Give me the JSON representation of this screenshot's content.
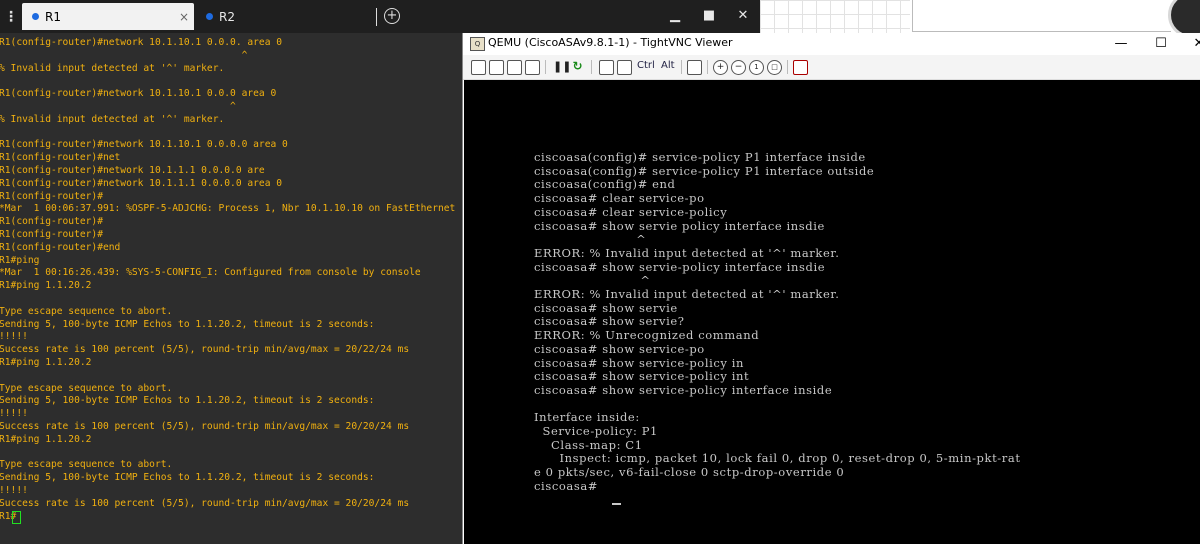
{
  "tabs": [
    {
      "label": "R1",
      "close": "×"
    },
    {
      "label": "R2",
      "close": "×"
    }
  ],
  "tab_menu_glyph": "⋮",
  "new_tab_glyph": "+",
  "window_controls": {
    "minimize": "▁",
    "maximize": "■",
    "close": "✕"
  },
  "terminal": {
    "text_color": "#f0b010",
    "lines": [
      "R1(config-router)#network 10.1.10.1 0.0.0. area 0",
      "                                          ^",
      "% Invalid input detected at '^' marker.",
      "",
      "R1(config-router)#network 10.1.10.1 0.0.0 area 0",
      "                                        ^",
      "% Invalid input detected at '^' marker.",
      "",
      "R1(config-router)#network 10.1.10.1 0.0.0.0 area 0",
      "R1(config-router)#net",
      "R1(config-router)#network 10.1.1.1 0.0.0.0 are",
      "R1(config-router)#network 10.1.1.1 0.0.0.0 area 0",
      "R1(config-router)#",
      "*Mar  1 00:06:37.991: %OSPF-5-ADJCHG: Process 1, Nbr 10.1.10.10 on FastEthernet",
      "R1(config-router)#",
      "R1(config-router)#",
      "R1(config-router)#end",
      "R1#ping",
      "*Mar  1 00:16:26.439: %SYS-5-CONFIG_I: Configured from console by console",
      "R1#ping 1.1.20.2",
      "",
      "Type escape sequence to abort.",
      "Sending 5, 100-byte ICMP Echos to 1.1.20.2, timeout is 2 seconds:",
      "!!!!!",
      "Success rate is 100 percent (5/5), round-trip min/avg/max = 20/22/24 ms",
      "R1#ping 1.1.20.2",
      "",
      "Type escape sequence to abort.",
      "Sending 5, 100-byte ICMP Echos to 1.1.20.2, timeout is 2 seconds:",
      "!!!!!",
      "Success rate is 100 percent (5/5), round-trip min/avg/max = 20/20/24 ms",
      "R1#ping 1.1.20.2",
      "",
      "Type escape sequence to abort.",
      "Sending 5, 100-byte ICMP Echos to 1.1.20.2, timeout is 2 seconds:",
      "!!!!!",
      "Success rate is 100 percent (5/5), round-trip min/avg/max = 20/20/24 ms",
      "R1#"
    ]
  },
  "vnc": {
    "title": "QEMU (CiscoASAv9.8.1-1) - TightVNC Viewer",
    "app_icon_text": "Q",
    "toolbar_ctrl": "Ctrl",
    "toolbar_alt": "Alt",
    "controls": {
      "minimize": "—",
      "maximize": "☐",
      "close": "✕"
    },
    "console_lines": [
      "ciscoasa(config)# service-policy P1 interface inside",
      "ciscoasa(config)# service-policy P1 interface outside",
      "ciscoasa(config)# end",
      "ciscoasa# clear service-po",
      "ciscoasa# clear service-policy",
      "ciscoasa# show servie policy interface insdie",
      "                        ^",
      "ERROR: % Invalid input detected at '^' marker.",
      "ciscoasa# show servie-policy interface insdie",
      "                         ^",
      "ERROR: % Invalid input detected at '^' marker.",
      "ciscoasa# show servie",
      "ciscoasa# show servie?",
      "ERROR: % Unrecognized command",
      "ciscoasa# show service-po",
      "ciscoasa# show service-policy in",
      "ciscoasa# show service-policy int",
      "ciscoasa# show service-policy interface inside",
      "",
      "Interface inside:",
      "  Service-policy: P1",
      "    Class-map: C1",
      "      Inspect: icmp, packet 10, lock fail 0, drop 0, reset-drop 0, 5-min-pkt-rat",
      "e 0 pkts/sec, v6-fail-close 0 sctp-drop-override 0",
      "ciscoasa# "
    ]
  }
}
